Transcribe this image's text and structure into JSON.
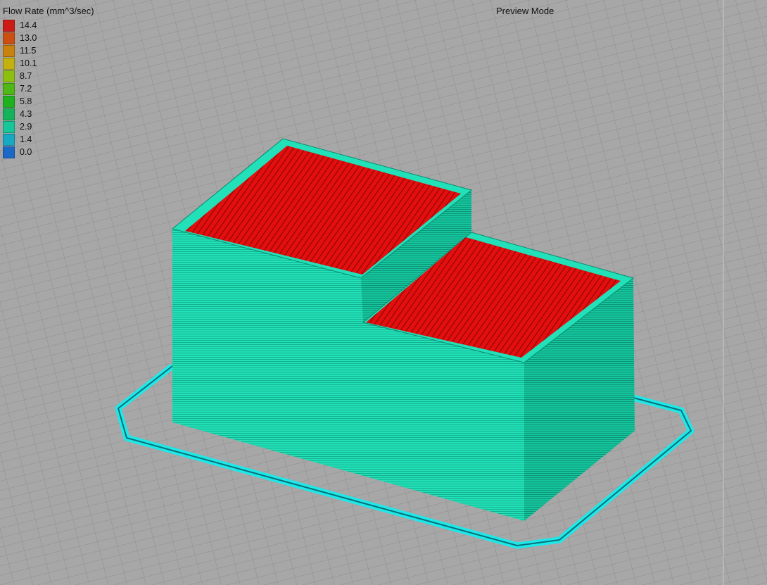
{
  "legend": {
    "title": "Flow Rate (mm^3/sec)",
    "items": [
      {
        "value": "14.4",
        "color": "#cc1a16"
      },
      {
        "value": "13.0",
        "color": "#cc4f12"
      },
      {
        "value": "11.5",
        "color": "#c7820f"
      },
      {
        "value": "10.1",
        "color": "#c2b10e"
      },
      {
        "value": "8.7",
        "color": "#8cbf10"
      },
      {
        "value": "7.2",
        "color": "#4fb716"
      },
      {
        "value": "5.8",
        "color": "#1fb21f"
      },
      {
        "value": "4.3",
        "color": "#14b35c"
      },
      {
        "value": "2.9",
        "color": "#17c79a"
      },
      {
        "value": "1.4",
        "color": "#17a8c2"
      },
      {
        "value": "0.0",
        "color": "#1c68c6"
      }
    ]
  },
  "header": {
    "mode_label": "Preview Mode"
  },
  "scene": {
    "background_color": "#a7a7a7",
    "grid_color": "#8f8f8f",
    "wall_color": "#22e0b8",
    "wall_shade_color": "#12b993",
    "infill_color": "#e30f0f",
    "skirt_color": "#1ee8e8"
  }
}
